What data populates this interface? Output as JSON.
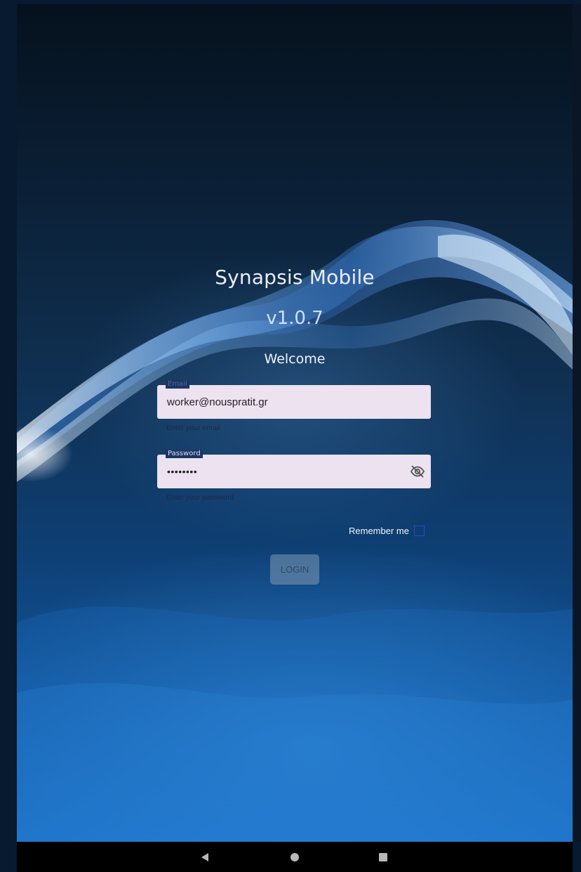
{
  "app": {
    "title": "Synapsis Mobile",
    "version": "v1.0.7",
    "welcome": "Welcome"
  },
  "form": {
    "email": {
      "label": "Email",
      "value": "worker@nouspratit.gr",
      "helper": "Enter your email"
    },
    "password": {
      "label": "Password",
      "value": "••••••••",
      "helper": "Enter your password",
      "toggle_icon": "eye-off-icon"
    },
    "remember_me": {
      "label": "Remember me",
      "checked": false
    },
    "login_label": "LOGIN"
  },
  "navigation_bar": {
    "icons": [
      "back-icon",
      "home-icon",
      "recents-icon"
    ]
  },
  "colors": {
    "field_background": "#ece2f0",
    "checkbox_border": "#3a3fd8",
    "navbar": "#000000"
  }
}
